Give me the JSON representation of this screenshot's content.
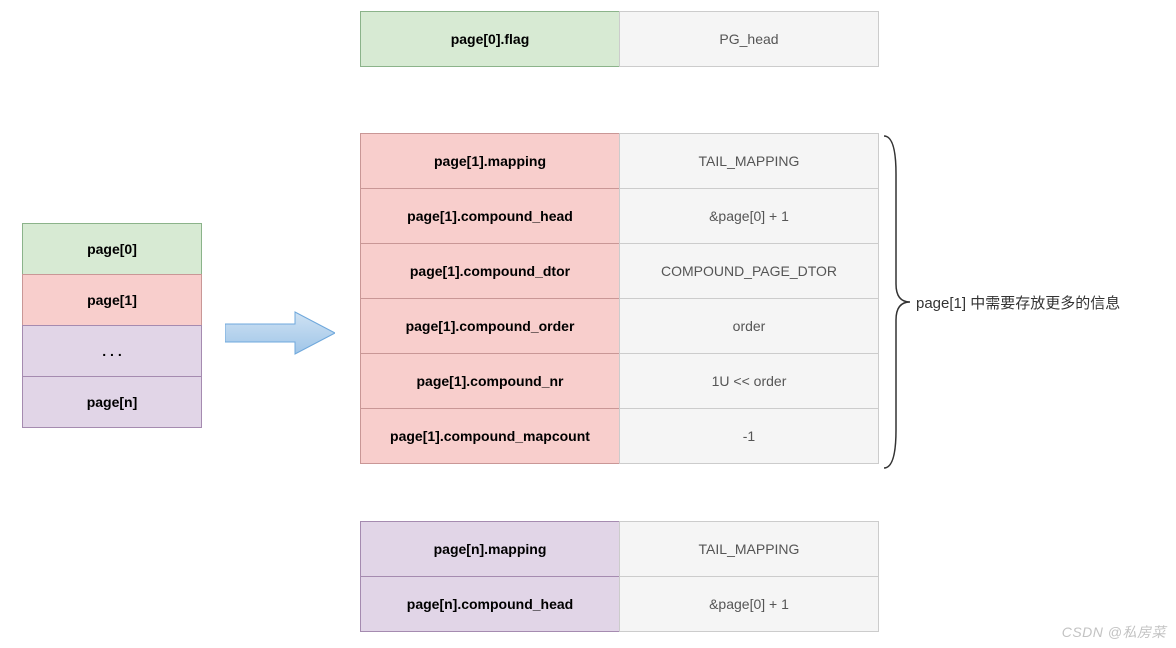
{
  "left": {
    "rows": [
      "page[0]",
      "page[1]",
      ". . .",
      "page[n]"
    ],
    "colors": [
      "green",
      "red",
      "purple",
      "purple"
    ]
  },
  "table0": {
    "color": "green",
    "rows": [
      {
        "label": "page[0].flag",
        "value": "PG_head"
      }
    ]
  },
  "table1": {
    "color": "red",
    "rows": [
      {
        "label": "page[1].mapping",
        "value": "TAIL_MAPPING"
      },
      {
        "label": "page[1].compound_head",
        "value": "&page[0] + 1"
      },
      {
        "label": "page[1].compound_dtor",
        "value": "COMPOUND_PAGE_DTOR"
      },
      {
        "label": "page[1].compound_order",
        "value": "order"
      },
      {
        "label": "page[1].compound_nr",
        "value": "1U << order"
      },
      {
        "label": "page[1].compound_mapcount",
        "value": "-1"
      }
    ]
  },
  "tablen": {
    "color": "purple",
    "rows": [
      {
        "label": "page[n].mapping",
        "value": "TAIL_MAPPING"
      },
      {
        "label": "page[n].compound_head",
        "value": "&page[0] + 1"
      }
    ]
  },
  "annotation": "page[1] 中需要存放更多的信息",
  "watermark": "CSDN @私房菜"
}
